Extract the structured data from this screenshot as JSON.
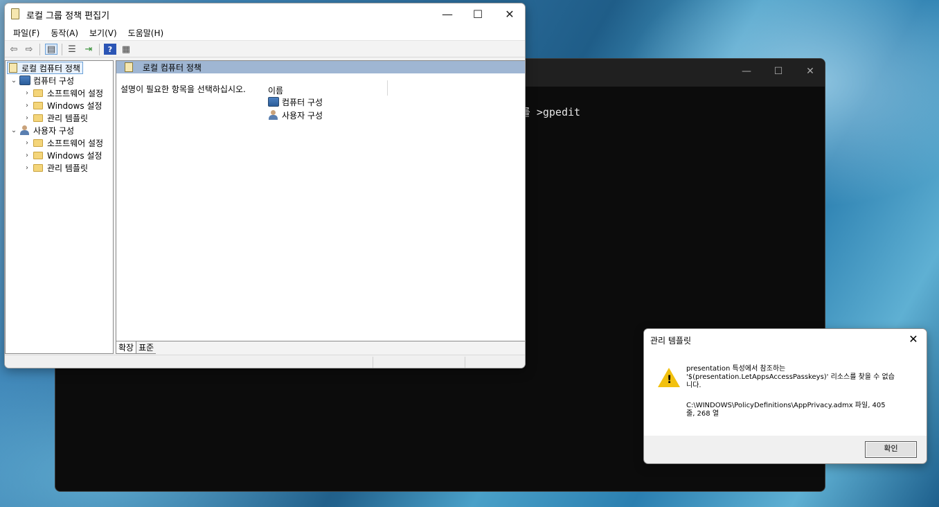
{
  "terminal": {
    "command_text": "를 >gpedit",
    "controls": [
      "—",
      "☐",
      "✕"
    ]
  },
  "gpe": {
    "title": "로컬 그룹 정책 편집기",
    "controls": [
      "—",
      "☐",
      "✕"
    ],
    "menu": [
      "파일(F)",
      "동작(A)",
      "보기(V)",
      "도움말(H)"
    ],
    "tree": {
      "root": "로컬 컴퓨터 정책",
      "computer": "컴퓨터 구성",
      "computer_children": [
        "소프트웨어 설정",
        "Windows 설정",
        "관리 템플릿"
      ],
      "user": "사용자 구성",
      "user_children": [
        "소프트웨어 설정",
        "Windows 설정",
        "관리 템플릿"
      ]
    },
    "right": {
      "header": "로컬 컴퓨터 정책",
      "description": "설명이 필요한 항목을 선택하십시오.",
      "column_name": "이름",
      "items": [
        "컴퓨터 구성",
        "사용자 구성"
      ]
    },
    "tabs": [
      "확장",
      "표준"
    ]
  },
  "dialog": {
    "title": "관리 템플릿",
    "close": "✕",
    "message_line1": "presentation 특성에서 참조하는",
    "message_line2": "'$(presentation.LetAppsAccessPasskeys)' 리소스를 찾을 수 없습",
    "message_line3": "니다.",
    "path_line1": "C:\\WINDOWS\\PolicyDefinitions\\AppPrivacy.admx 파일, 405",
    "path_line2": "줄, 268 열",
    "ok_button": "확인"
  }
}
